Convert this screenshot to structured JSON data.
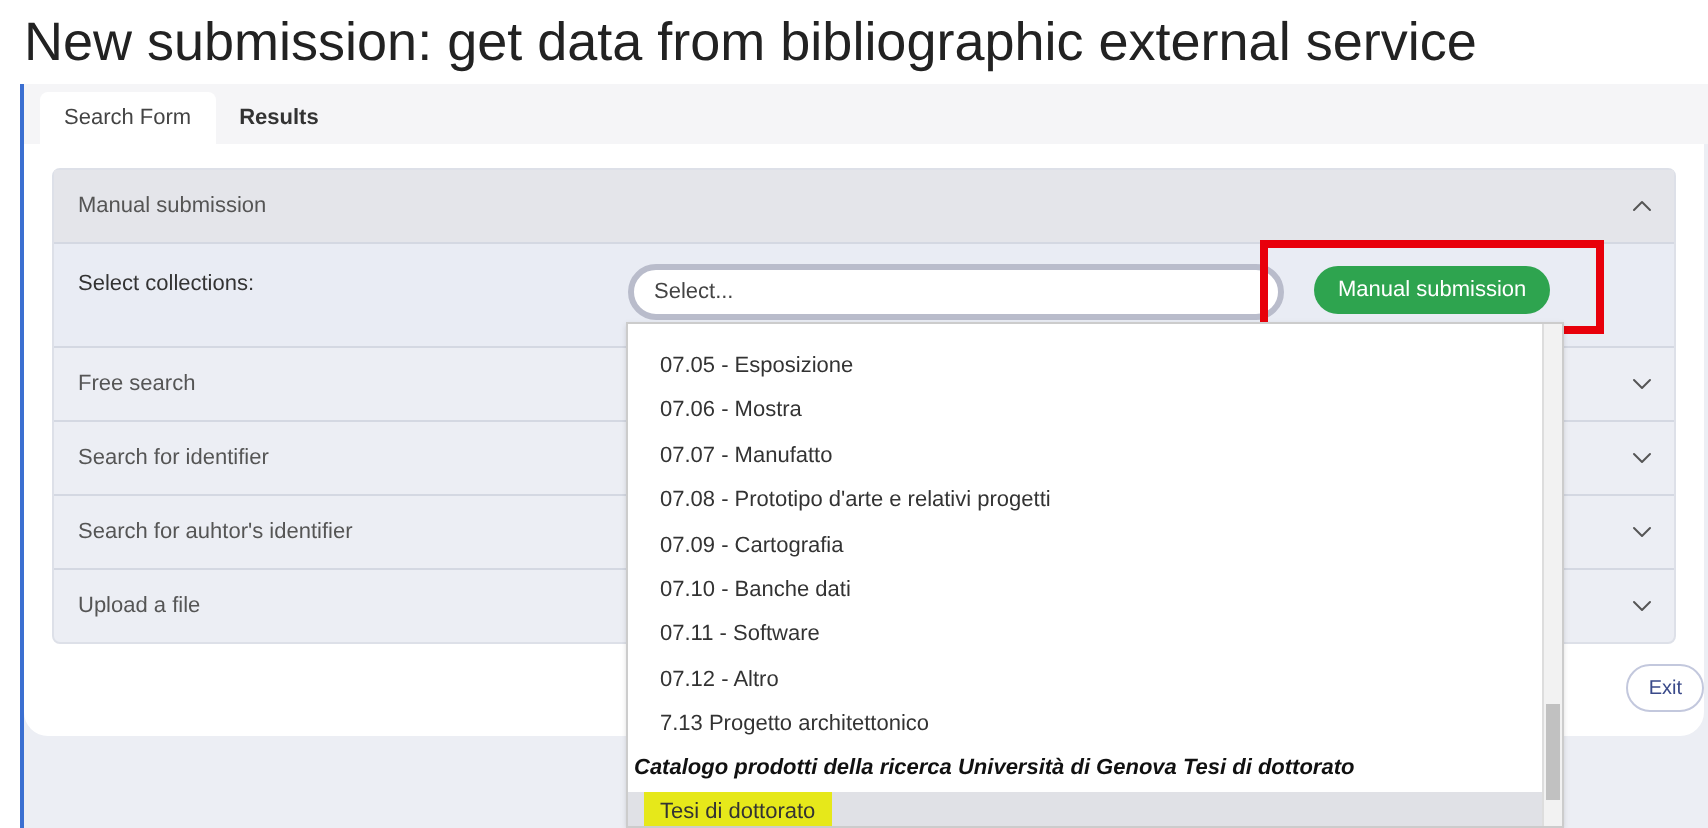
{
  "page_title": "New submission: get data from bibliographic external service",
  "tabs": [
    {
      "label": "Search Form",
      "selected": true
    },
    {
      "label": "Results",
      "selected": false
    }
  ],
  "accordion": [
    {
      "title": "Manual submission",
      "expanded": true
    },
    {
      "title": "Free search",
      "expanded": false
    },
    {
      "title": "Search for identifier",
      "expanded": false
    },
    {
      "title": "Search for auhtor's identifier",
      "expanded": false
    },
    {
      "title": "Upload a file",
      "expanded": false
    }
  ],
  "manual_form": {
    "label": "Select collections:",
    "select": {
      "placeholder": "Select..."
    },
    "button": "Manual submission",
    "button_annotated": true
  },
  "dropdown": {
    "options": [
      {
        "kind": "option",
        "label": "07.05 - Esposizione",
        "selected": false,
        "highlighted": false
      },
      {
        "kind": "option",
        "label": "07.06 - Mostra",
        "selected": false,
        "highlighted": false
      },
      {
        "kind": "option",
        "label": "07.07 - Manufatto",
        "selected": false,
        "highlighted": false
      },
      {
        "kind": "option",
        "label": "07.08 - Prototipo d'arte e relativi progetti",
        "selected": false,
        "highlighted": false
      },
      {
        "kind": "option",
        "label": "07.09 - Cartografia",
        "selected": false,
        "highlighted": false
      },
      {
        "kind": "option",
        "label": "07.10 - Banche dati",
        "selected": false,
        "highlighted": false
      },
      {
        "kind": "option",
        "label": "07.11 - Software",
        "selected": false,
        "highlighted": false
      },
      {
        "kind": "option",
        "label": "07.12 - Altro",
        "selected": false,
        "highlighted": false
      },
      {
        "kind": "option",
        "label": "7.13 Progetto architettonico",
        "selected": false,
        "highlighted": false
      },
      {
        "kind": "group",
        "label": "Catalogo prodotti della ricerca Università di Genova Tesi di dottorato"
      },
      {
        "kind": "option",
        "label": "Tesi di dottorato",
        "selected": true,
        "highlighted": true
      }
    ]
  },
  "exit_button": "Exit"
}
